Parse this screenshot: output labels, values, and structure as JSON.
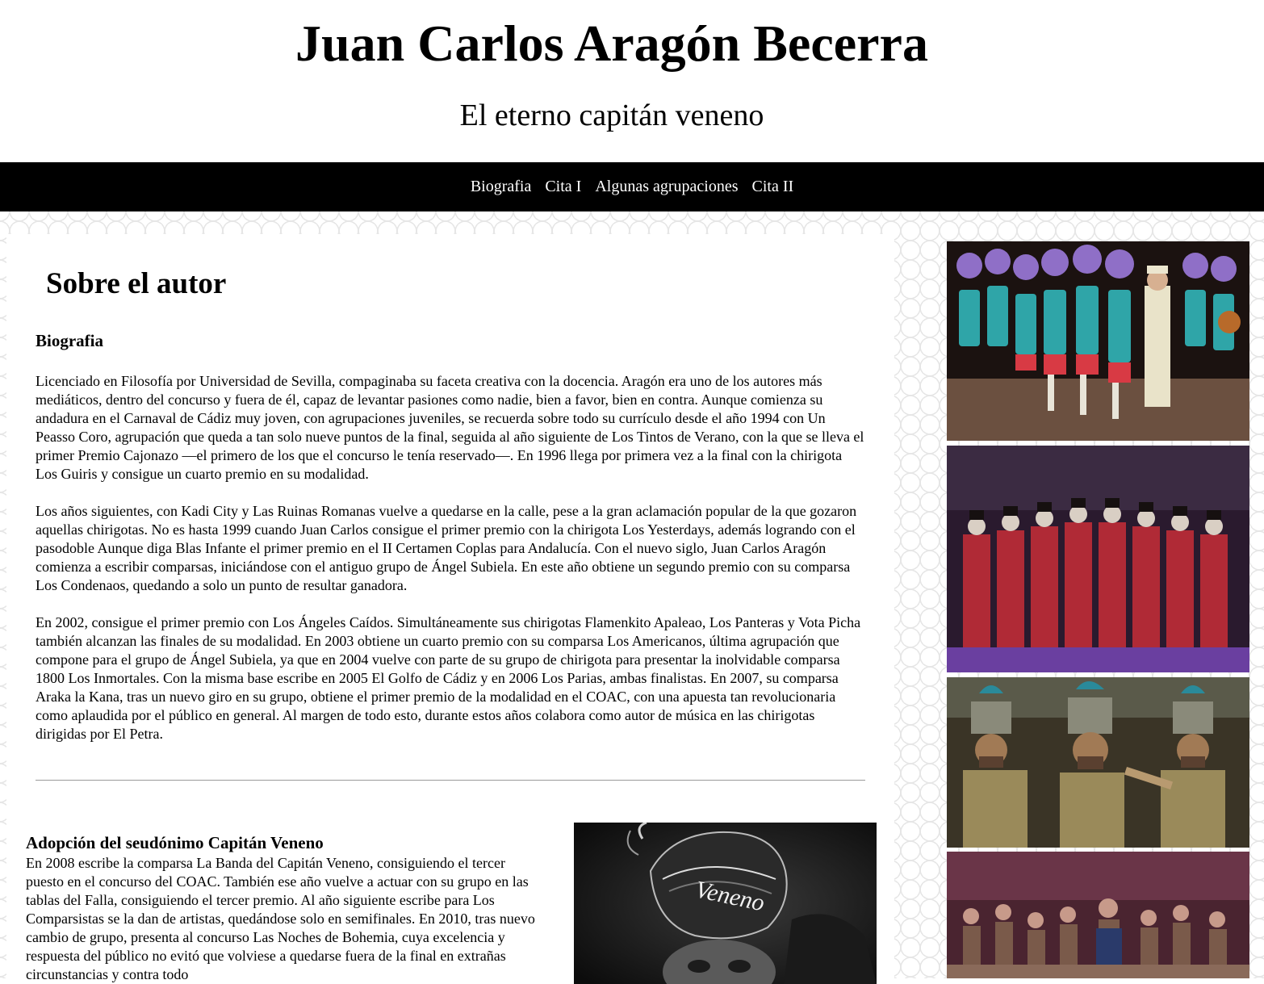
{
  "header": {
    "title": "Juan Carlos Aragón Becerra",
    "subtitle": "El eterno capitán veneno"
  },
  "nav": {
    "items": [
      {
        "label": "Biografia"
      },
      {
        "label": "Cita I"
      },
      {
        "label": "Algunas agrupaciones"
      },
      {
        "label": "Cita II"
      }
    ]
  },
  "main": {
    "section_title": "Sobre el autor",
    "bio_heading": "Biografia",
    "bio_paragraphs": [
      "Licenciado en Filosofía por Universidad de Sevilla, compaginaba su faceta creativa con la docencia. Aragón era uno de los autores más mediáticos, dentro del concurso y fuera de él, capaz de levantar pasiones como nadie, bien a favor, bien en contra. Aunque comienza su andadura en el Carnaval de Cádiz muy joven, con agrupaciones juveniles, se recuerda sobre todo su currículo desde el año 1994 con Un Peasso Coro, agrupación que queda a tan solo nueve puntos de la final, seguida al año siguiente de Los Tintos de Verano, con la que se lleva el primer Premio Cajonazo —el primero de los que el concurso le tenía reservado—. En 1996 llega por primera vez a la final con la chirigota Los Guiris y consigue un cuarto premio en su modalidad.",
      "Los años siguientes, con Kadi City y Las Ruinas Romanas vuelve a quedarse en la calle, pese a la gran aclamación popular de la que gozaron aquellas chirigotas. No es hasta 1999 cuando Juan Carlos consigue el primer premio con la chirigota Los Yesterdays, además logrando con el pasodoble Aunque diga Blas Infante el primer premio en el II Certamen Coplas para Andalucía. Con el nuevo siglo, Juan Carlos Aragón comienza a escribir comparsas, iniciándose con el antiguo grupo de Ángel Subiela. En este año obtiene un segundo premio con su comparsa Los Condenaos, quedando a solo un punto de resultar ganadora.",
      "En 2002, consigue el primer premio con Los Ángeles Caídos. Simultáneamente sus chirigotas Flamenkito Apaleao, Los Panteras y Vota Picha también alcanzan las finales de su modalidad. En 2003 obtiene un cuarto premio con su comparsa Los Americanos, última agrupación que compone para el grupo de Ángel Subiela, ya que en 2004 vuelve con parte de su grupo de chirigota para presentar la inolvidable comparsa 1800 Los Inmortales. Con la misma base escribe en 2005 El Golfo de Cádiz y en 2006 Los Parias, ambas finalistas. En 2007, su comparsa Araka la Kana, tras un nuevo giro en su grupo, obtiene el primer premio de la modalidad en el COAC, con una apuesta tan revolucionaria como aplaudida por el público en general. Al margen de todo esto, durante estos años colabora como autor de música en las chirigotas dirigidas por El Petra."
    ],
    "pseudonym_heading": "Adopción del seudónimo Capitán Veneno",
    "pseudonym_text": "En 2008 escribe la comparsa La Banda del Capitán Veneno, consiguiendo el tercer puesto en el concurso del COAC. También ese año vuelve a actuar con su grupo en las tablas del Falla, consiguiendo el tercer premio. Al año siguiente escribe para Los Comparsistas se la dan de artistas, quedándose solo en semifinales. En 2010, tras nuevo cambio de grupo, presenta al concurso Las Noches de Bohemia, cuya excelencia y respuesta del público no evitó que volviese a quedarse fuera de la final en extrañas circunstancias y contra todo",
    "photo_hat_text": "Veneno"
  },
  "gallery": {
    "images": [
      {
        "name": "gallery-photo-teal-costumes"
      },
      {
        "name": "gallery-photo-red-coats"
      },
      {
        "name": "gallery-photo-green-hats"
      },
      {
        "name": "gallery-photo-stage-crowd"
      }
    ]
  }
}
